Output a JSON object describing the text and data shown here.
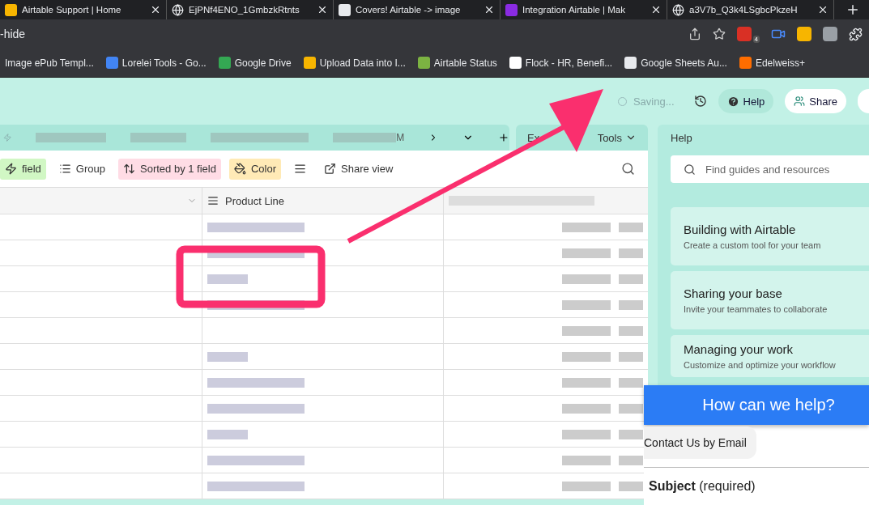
{
  "browser_tabs": [
    {
      "title": "Airtable Support | Home"
    },
    {
      "title": "EjPNf4ENO_1GmbzkRtnts"
    },
    {
      "title": "Covers! Airtable -> image"
    },
    {
      "title": "Integration Airtable | Mak"
    },
    {
      "title": "a3V7b_Q3k4LSgbcPkzeH"
    }
  ],
  "address": {
    "url": "-hide",
    "badge": "4"
  },
  "bookmarks": [
    {
      "label": "Image ePub Templ..."
    },
    {
      "label": "Lorelei Tools - Go..."
    },
    {
      "label": "Google Drive"
    },
    {
      "label": "Upload Data into I..."
    },
    {
      "label": "Airtable Status"
    },
    {
      "label": "Flock - HR, Benefi..."
    },
    {
      "label": "Google Sheets Au..."
    },
    {
      "label": "Edelweiss+"
    }
  ],
  "topbar": {
    "status": "Saving...",
    "help": "Help",
    "share": "Share"
  },
  "table_tabs": {
    "tail": "M",
    "ext": "Ex",
    "tools": "Tools"
  },
  "toolbar": [
    {
      "label": "field",
      "kind": "filter"
    },
    {
      "label": "Group",
      "kind": "group"
    },
    {
      "label": "Sorted by 1 field",
      "kind": "sort"
    },
    {
      "label": "Color",
      "kind": "color"
    },
    {
      "kind": "height"
    },
    {
      "label": "Share view",
      "kind": "share"
    }
  ],
  "columns": [
    {
      "label": "Product Line"
    }
  ],
  "help_panel": {
    "title": "Help",
    "placeholder": "Find guides and resources",
    "cards": [
      {
        "title": "Building with Airtable",
        "text": "Create a custom tool for your team"
      },
      {
        "title": "Sharing your base",
        "text": "Invite your teammates to collaborate"
      },
      {
        "title": "Managing your work",
        "text": "Customize and optimize your workflow"
      }
    ]
  },
  "chat": {
    "title": "How can we help?",
    "bubble": "Contact Us by Email",
    "field": "Subject",
    "hint": "(required)"
  }
}
